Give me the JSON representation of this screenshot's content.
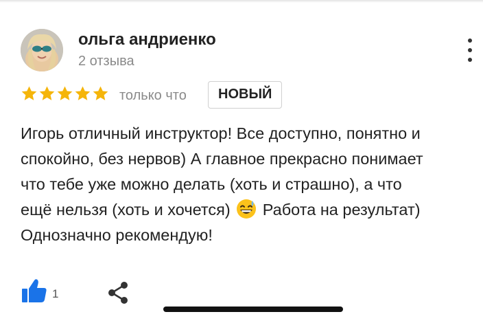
{
  "review": {
    "author": {
      "name": "ольга андриенко",
      "reviews_count": "2 отзыва"
    },
    "rating": 5,
    "rating_max": 5,
    "time": "только что",
    "badge": "НОВЫЙ",
    "text_lines": [
      "Игорь отличный инструктор! Все доступно, понятно и",
      "спокойно, без нервов) А главное прекрасно понимает",
      "что тебе уже можно делать (хоть и страшно), а что",
      "ещё нельзя (хоть и хочется)",
      "Работа на результат)",
      "Однозначно рекомендую!"
    ],
    "likes": "1"
  },
  "icons": {
    "menu": "more-vertical-icon",
    "star": "star-icon",
    "emoji": "grinning-sweat-emoji-icon",
    "like": "thumbs-up-icon",
    "share": "share-icon"
  },
  "colors": {
    "star": "#f5b50a",
    "like": "#1a73e8",
    "muted_text": "#8a8a8a",
    "badge_border": "#cfcfcf"
  }
}
